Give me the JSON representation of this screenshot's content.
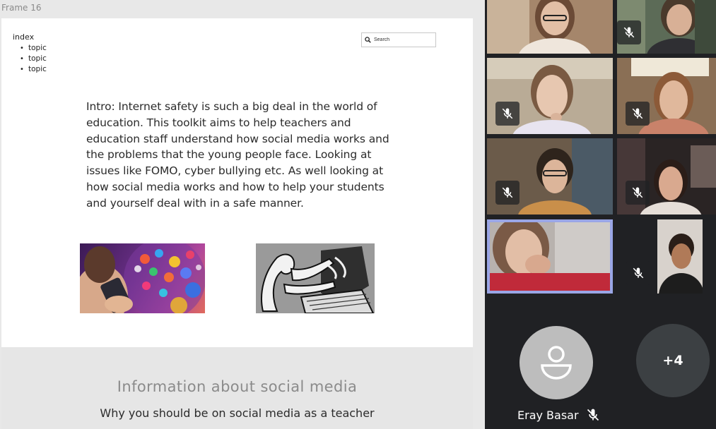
{
  "canvas": {
    "frame_label": "Frame 16",
    "index": {
      "title": "index",
      "items": [
        "topic",
        "topic",
        "topic"
      ]
    },
    "search": {
      "placeholder": "Search"
    },
    "intro": "Intro: Internet safety is such a big deal in the world of education. This toolkit aims to help teachers and education staff understand how social media works and the problems that the young people face. Looking at issues like FOMO, cyber bullying etc. As well looking at how social media works and how to help your students and yourself deal with in a safe manner.",
    "section": {
      "title": "Information about social media",
      "subtitle": "Why you should be on social media as a teacher"
    }
  },
  "call": {
    "participant_name": "Eray Basar",
    "more_participants": "+4",
    "accent_color": "#9aa6e6",
    "icons": [
      "mic-off-icon",
      "person-icon"
    ]
  }
}
